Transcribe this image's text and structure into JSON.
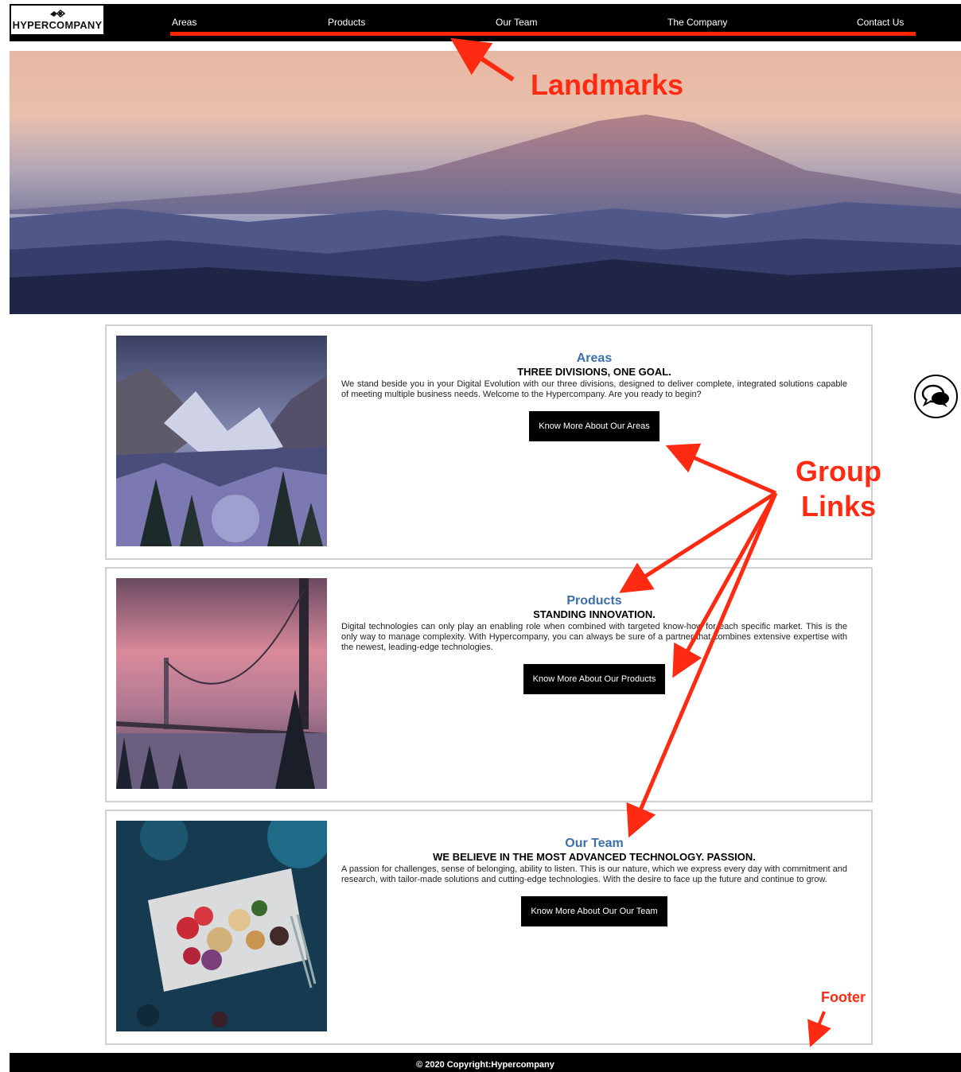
{
  "brand": {
    "name": "HYPERCOMPANY"
  },
  "nav": {
    "items": [
      {
        "label": "Areas"
      },
      {
        "label": "Products"
      },
      {
        "label": "Our Team"
      },
      {
        "label": "The Company"
      },
      {
        "label": "Contact Us"
      }
    ]
  },
  "sections": [
    {
      "title": "Areas",
      "subtitle": "THREE DIVISIONS, ONE GOAL.",
      "text": "We stand beside you in your Digital Evolution with our three divisions, designed to deliver complete, integrated solutions capable of meeting multiple business needs. Welcome to the Hypercompany. Are you ready to begin?",
      "button": "Know More About Our Areas"
    },
    {
      "title": "Products",
      "subtitle": "STANDING INNOVATION.",
      "text": "Digital technologies can only play an enabling role when combined with targeted know-how for each specific market. This is the only way to manage complexity. With Hypercompany, you can always be sure of a partner that combines extensive expertise with the newest, leading-edge technologies.",
      "button": "Know More About Our Products"
    },
    {
      "title": "Our Team",
      "subtitle": "WE BELIEVE IN THE MOST ADVANCED TECHNOLOGY. PASSION.",
      "text": "A passion for challenges, sense of belonging, ability to listen. This is our nature, which we express every day with commitment and research, with tailor-made solutions and cutting-edge technologies. With the desire to face up the future and continue to grow.",
      "button": "Know More About Our Our Team"
    }
  ],
  "footer": {
    "copyright": "© 2020 Copyright:Hypercompany"
  },
  "annotations": {
    "landmarks": "Landmarks",
    "group_line1": "Group",
    "group_line2": "Links",
    "footer": "Footer"
  },
  "colors": {
    "accent": "#ff2600",
    "title_blue": "#3c6fa8",
    "header_bg": "#000000"
  },
  "icons": [
    "logo-mark-icon",
    "chat-bubble-icon"
  ]
}
